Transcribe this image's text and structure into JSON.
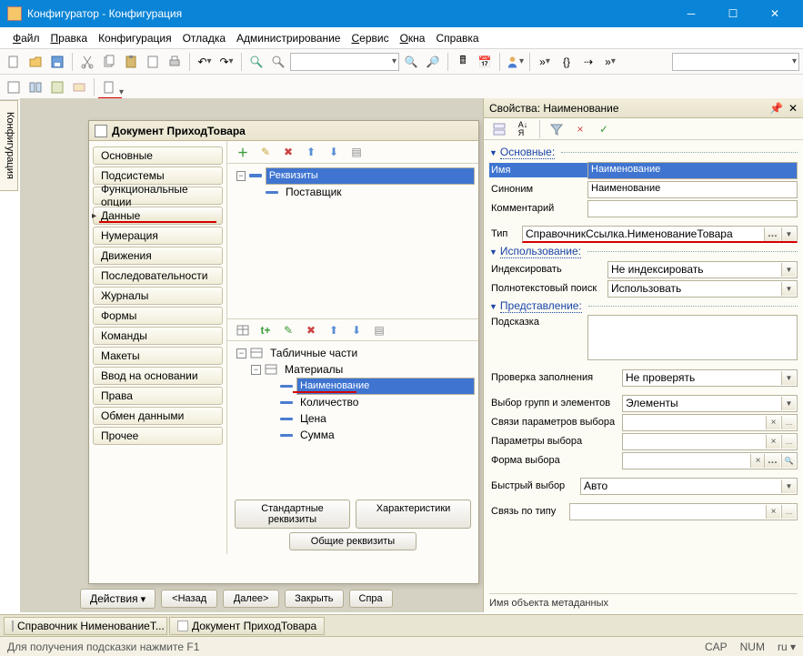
{
  "titlebar": {
    "text": "Конфигуратор - Конфигурация"
  },
  "menu": {
    "file": "Файл",
    "edit": "Правка",
    "config": "Конфигурация",
    "debug": "Отладка",
    "admin": "Администрирование",
    "service": "Сервис",
    "windows": "Окна",
    "help": "Справка"
  },
  "sidetab": "Конфигурация",
  "doc": {
    "title": "Документ ПриходТовара",
    "nav": {
      "items": [
        "Основные",
        "Подсистемы",
        "Функциональные опции",
        "Данные",
        "Нумерация",
        "Движения",
        "Последовательности",
        "Журналы",
        "Формы",
        "Команды",
        "Макеты",
        "Ввод на основании",
        "Права",
        "Обмен данными",
        "Прочее"
      ],
      "active_index": 3
    },
    "tree_top": {
      "root": "Реквизиты",
      "child1": "Поставщик"
    },
    "tree_bottom": {
      "root": "Табличные части",
      "group": "Материалы",
      "items": [
        "Наименование",
        "Количество",
        "Цена",
        "Сумма"
      ],
      "selected_index": 0
    },
    "btns": {
      "std": "Стандартные реквизиты",
      "char": "Характеристики",
      "common": "Общие реквизиты"
    },
    "actions": {
      "actions": "Действия",
      "back": "<Назад",
      "next": "Далее>",
      "close": "Закрыть",
      "help": "Спра"
    }
  },
  "props": {
    "title": "Свойства: Наименование",
    "sect_main": "Основные:",
    "name_lbl": "Имя",
    "name_val": "Наименование",
    "syn_lbl": "Синоним",
    "syn_val": "Наименование",
    "comment_lbl": "Комментарий",
    "comment_val": "",
    "type_lbl": "Тип",
    "type_val": "СправочникСсылка.НименованиеТовара",
    "sect_use": "Использование:",
    "index_lbl": "Индексировать",
    "index_val": "Не индексировать",
    "fts_lbl": "Полнотекстовый поиск",
    "fts_val": "Использовать",
    "sect_view": "Представление:",
    "hint_lbl": "Подсказка",
    "fillcheck_lbl": "Проверка заполнения",
    "fillcheck_val": "Не проверять",
    "groupsel_lbl": "Выбор групп и элементов",
    "groupsel_val": "Элементы",
    "linkparams_lbl": "Связи параметров выбора",
    "selparams_lbl": "Параметры выбора",
    "selform_lbl": "Форма выбора",
    "quicksel_lbl": "Быстрый выбор",
    "quicksel_val": "Авто",
    "typelink_lbl": "Связь по типу",
    "metaname_lbl": "Имя объекта метаданных"
  },
  "wintabs": {
    "t1": "Справочник НименованиеТ...",
    "t2": "Документ ПриходТовара"
  },
  "status": {
    "hint": "Для получения подсказки нажмите F1",
    "cap": "CAP",
    "num": "NUM",
    "lang": "ru"
  }
}
